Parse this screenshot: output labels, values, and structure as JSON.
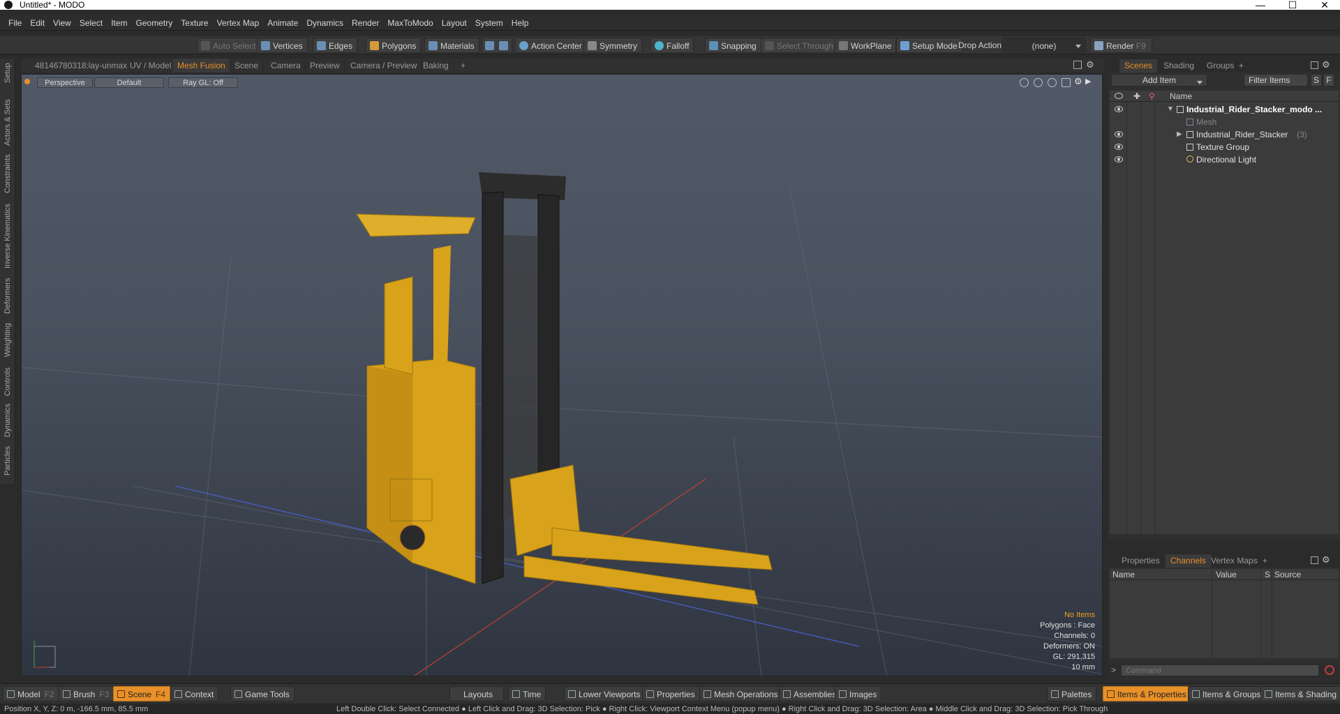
{
  "window": {
    "title": "Untitled* - MODO",
    "minimize": "—",
    "maximize": "☐",
    "close": "✕"
  },
  "menu": [
    "File",
    "Edit",
    "View",
    "Select",
    "Item",
    "Geometry",
    "Texture",
    "Vertex Map",
    "Animate",
    "Dynamics",
    "Render",
    "MaxToModo",
    "Layout",
    "System",
    "Help"
  ],
  "toolbar": {
    "auto_select": "Auto Select",
    "vertices": "Vertices",
    "edges": "Edges",
    "polygons": "Polygons",
    "materials": "Materials",
    "action_center": "Action Center",
    "symmetry": "Symmetry",
    "falloff": "Falloff",
    "snapping": "Snapping",
    "select_through": "Select Through",
    "workplane": "WorkPlane",
    "setup_mode": "Setup Mode",
    "drop_action": "Drop Action",
    "drop_value": "(none)",
    "render": "Render",
    "render_key": "F9"
  },
  "viewport_tabs": [
    "48146780318:lay-unmax",
    "UV / Model",
    "Mesh Fusion",
    "Scene",
    "Camera",
    "Preview",
    "Camera / Preview",
    "Baking",
    "+"
  ],
  "left_tabs": [
    "Setup",
    "Actors & Sets",
    "Constraints",
    "Inverse Kinematics",
    "Deformers",
    "Weighting",
    "Controls",
    "Dynamics",
    "Particles"
  ],
  "viewport": {
    "view": "Perspective",
    "shading": "Default",
    "raygl": "Ray GL: Off",
    "hud": {
      "items": "No Items",
      "polygons": "Polygons : Face",
      "channels": "Channels: 0",
      "deformers": "Deformers: ON",
      "gl": "GL: 291,315",
      "unit": "10 mm"
    }
  },
  "right_tabs": [
    "Scenes",
    "Shading",
    "Groups",
    "+"
  ],
  "scene": {
    "add_item": "Add Item",
    "filter": "Filter Items",
    "s_btn": "S",
    "f_btn": "F",
    "col_name": "Name",
    "items": [
      {
        "name": "Industrial_Rider_Stacker_modo ...",
        "level": 0,
        "bold": true
      },
      {
        "name": "Mesh",
        "level": 1,
        "dim": true
      },
      {
        "name": "Industrial_Rider_Stacker",
        "count": "(3)",
        "level": 1
      },
      {
        "name": "Texture Group",
        "level": 1
      },
      {
        "name": "Directional Light",
        "level": 1
      }
    ]
  },
  "props_tabs": [
    "Properties",
    "Channels",
    "Vertex Maps",
    "+"
  ],
  "channels": {
    "cols": [
      "Name",
      "Value",
      "S",
      "Source"
    ]
  },
  "command_placeholder": "Command",
  "bottom": {
    "model": "Model",
    "model_key": "F2",
    "brush": "Brush",
    "brush_key": "F3",
    "scene": "Scene",
    "scene_key": "F4",
    "context": "Context",
    "game_tools": "Game Tools",
    "layouts": "Layouts",
    "time": "Time",
    "lower_viewports": "Lower Viewports",
    "properties": "Properties",
    "mesh_operations": "Mesh Operations",
    "assemblies": "Assemblies",
    "images": "Images",
    "palettes": "Palettes",
    "items_properties": "Items & Properties",
    "items_groups": "Items & Groups",
    "items_shading": "Items & Shading"
  },
  "status": {
    "position": "Position X, Y, Z:  0 m, -166.5 mm, 85.5 mm",
    "hint": "Left Double Click: Select Connected ● Left Click and Drag: 3D Selection: Pick ● Right Click: Viewport Context Menu (popup menu) ● Right Click and Drag: 3D Selection: Area ● Middle Click and Drag: 3D Selection: Pick Through"
  },
  "colors": {
    "accent": "#e8902a",
    "forklift_yellow": "#e0a820",
    "forklift_black": "#2a2a2a"
  }
}
